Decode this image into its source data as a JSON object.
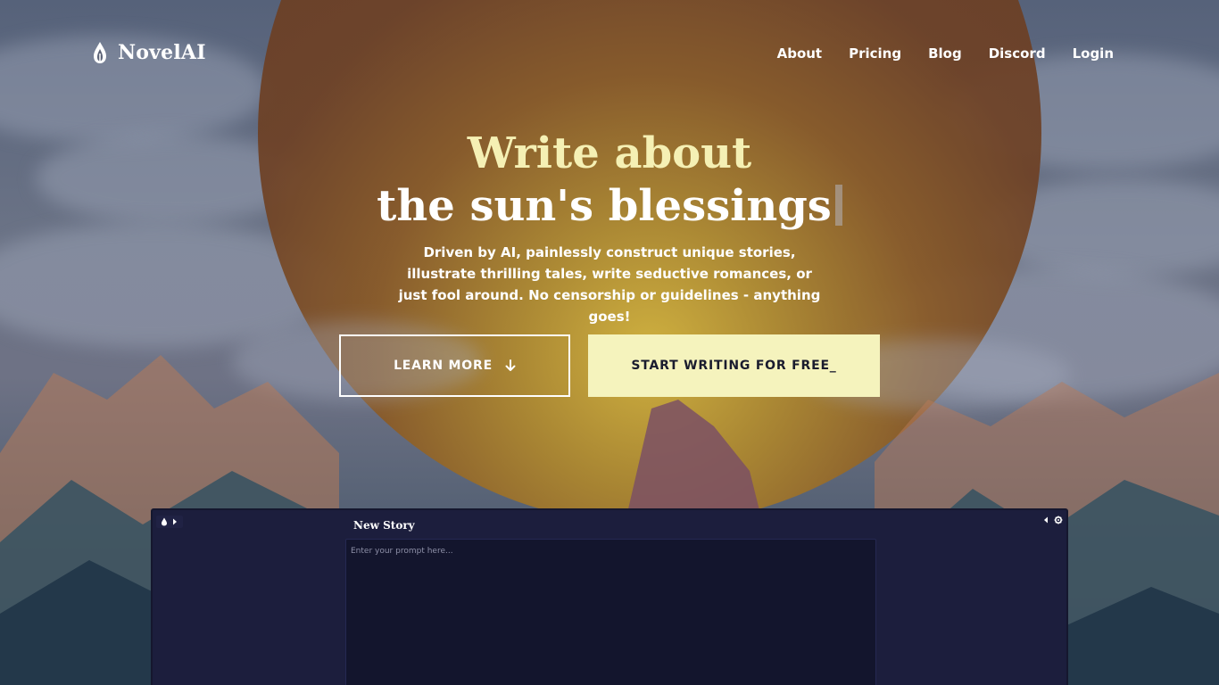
{
  "brand": {
    "name": "NovelAI",
    "icon": "quill-flame-icon"
  },
  "nav": {
    "items": [
      "About",
      "Pricing",
      "Blog",
      "Discord",
      "Login"
    ]
  },
  "hero": {
    "headline_line1": "Write about",
    "headline_line2": "the sun's blessings",
    "description": "Driven by AI, painlessly construct unique stories, illustrate thrilling tales, write seductive romances, or just fool around. No censorship or guidelines - anything goes!",
    "learn_more_label": "LEARN MORE",
    "learn_more_icon": "arrow-down-icon",
    "start_label": "START WRITING FOR FREE_"
  },
  "app_preview": {
    "title": "New Story",
    "prompt_placeholder": "Enter your prompt here...",
    "left_icons": [
      "logo-icon",
      "chevron-right-icon"
    ],
    "right_icons": [
      "chevron-left-icon",
      "gear-icon"
    ]
  },
  "colors": {
    "headline_accent": "#f5f0b4",
    "cta_background": "#f5f3bd",
    "panel_background": "#1c1e3d"
  }
}
